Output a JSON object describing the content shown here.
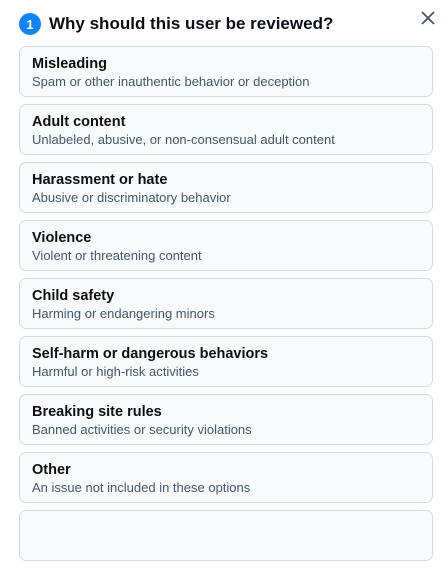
{
  "header": {
    "step": "1",
    "title": "Why should this user be reviewed?",
    "close_icon": "close-icon"
  },
  "options": [
    {
      "title": "Misleading",
      "description": "Spam or other inauthentic behavior or deception"
    },
    {
      "title": "Adult content",
      "description": "Unlabeled, abusive, or non-consensual adult content"
    },
    {
      "title": "Harassment or hate",
      "description": "Abusive or discriminatory behavior"
    },
    {
      "title": "Violence",
      "description": "Violent or threatening content"
    },
    {
      "title": "Child safety",
      "description": "Harming or endangering minors"
    },
    {
      "title": "Self-harm or dangerous behaviors",
      "description": "Harmful or high-risk activities"
    },
    {
      "title": "Breaking site rules",
      "description": "Banned activities or security violations"
    },
    {
      "title": "Other",
      "description": "An issue not included in these options"
    }
  ],
  "colors": {
    "accent": "#1083fe",
    "card_border": "#d4dbe2",
    "card_background": "#f9fafb",
    "muted_text": "#42576c"
  }
}
